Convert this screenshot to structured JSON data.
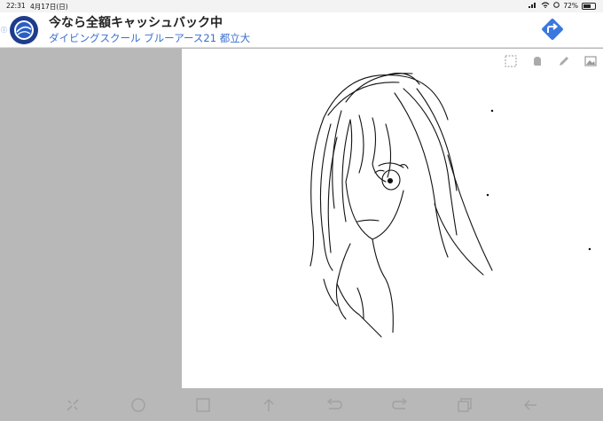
{
  "status_bar": {
    "time": "22:31",
    "date": "4月17日(日)",
    "battery": "72%"
  },
  "ad": {
    "info_label": "ⓘ",
    "title": "今なら全額キャッシュバック中",
    "subtitle": "ダイビングスクール ブルーアース21 都立大",
    "cta_icon": "directions-arrow-icon",
    "accent": "#3a6fd0"
  },
  "canvas": {
    "toolbar": [
      "select-rect-icon",
      "undo-hand-icon",
      "pencil-icon",
      "image-icon"
    ]
  },
  "nav": {
    "buttons": [
      "tools-icon",
      "circle-icon",
      "square-icon",
      "arrow-up-icon",
      "undo-icon",
      "redo-icon",
      "copy-icon",
      "back-arrow-icon"
    ]
  }
}
